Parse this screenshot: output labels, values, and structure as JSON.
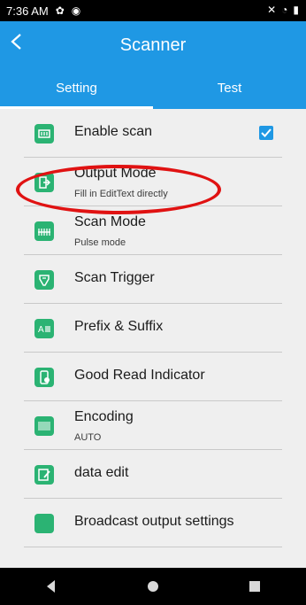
{
  "status_bar": {
    "time": "7:36 AM"
  },
  "app_bar": {
    "title": "Scanner"
  },
  "tabs": [
    {
      "label": "Setting",
      "active": true
    },
    {
      "label": "Test",
      "active": false
    }
  ],
  "items": [
    {
      "label": "Enable scan",
      "sub": "",
      "checked": true
    },
    {
      "label": "Output Mode",
      "sub": "Fill in EditText directly"
    },
    {
      "label": "Scan Mode",
      "sub": "Pulse mode"
    },
    {
      "label": "Scan Trigger",
      "sub": ""
    },
    {
      "label": "Prefix & Suffix",
      "sub": ""
    },
    {
      "label": "Good Read Indicator",
      "sub": ""
    },
    {
      "label": "Encoding",
      "sub": "AUTO"
    },
    {
      "label": "data edit",
      "sub": ""
    },
    {
      "label": "Broadcast output settings",
      "sub": ""
    }
  ],
  "colors": {
    "accent": "#1f98e4",
    "icon": "#2bb373",
    "highlight": "#e01212"
  }
}
